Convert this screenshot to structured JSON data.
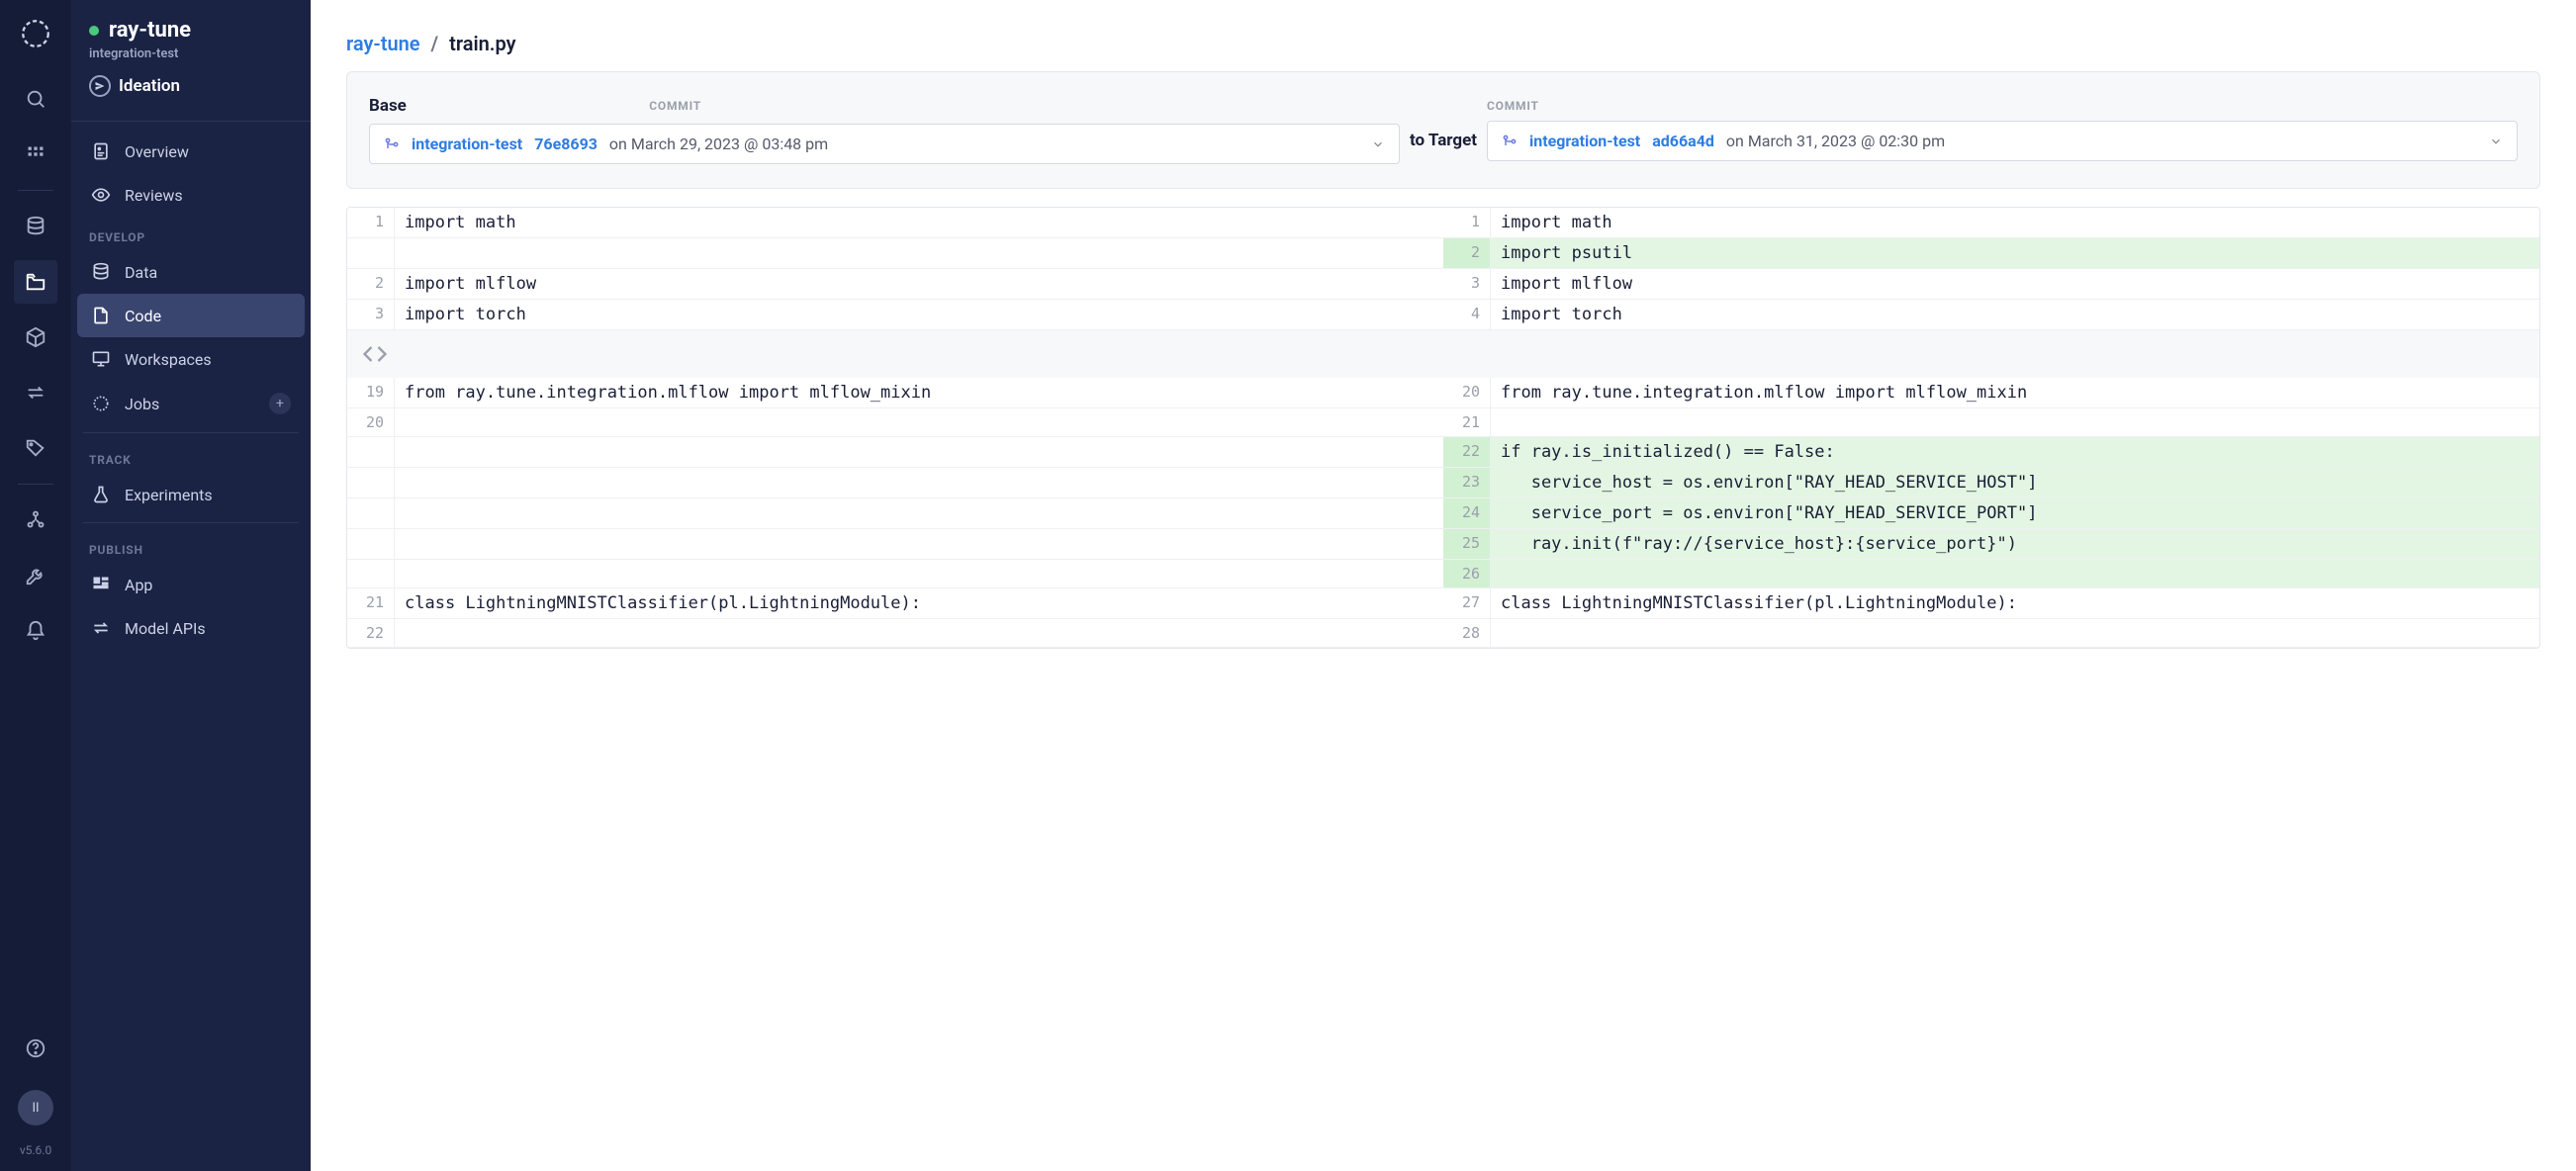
{
  "rail": {
    "version": "v5.6.0",
    "avatar_initials": "II"
  },
  "sidebar": {
    "project_title": "ray-tune",
    "project_subtitle": "integration-test",
    "stage_label": "Ideation",
    "sections": {
      "top": [
        {
          "label": "Overview"
        },
        {
          "label": "Reviews"
        }
      ],
      "develop_label": "DEVELOP",
      "develop": [
        {
          "label": "Data"
        },
        {
          "label": "Code"
        },
        {
          "label": "Workspaces"
        },
        {
          "label": "Jobs",
          "has_plus": true
        }
      ],
      "track_label": "TRACK",
      "track": [
        {
          "label": "Experiments"
        }
      ],
      "publish_label": "PUBLISH",
      "publish": [
        {
          "label": "App"
        },
        {
          "label": "Model APIs"
        }
      ]
    }
  },
  "breadcrumb": {
    "project": "ray-tune",
    "sep": "/",
    "file": "train.py"
  },
  "compare": {
    "base_label": "Base",
    "commit_label": "COMMIT",
    "to_target_label": "to Target",
    "base": {
      "branch": "integration-test",
      "hash": "76e8693",
      "date": "on March 29, 2023 @ 03:48 pm"
    },
    "target": {
      "branch": "integration-test",
      "hash": "ad66a4d",
      "date": "on March 31, 2023 @ 02:30 pm"
    }
  },
  "diff": {
    "rows": [
      {
        "l_no": "1",
        "l_code": "import math",
        "r_no": "1",
        "r_code": "import math",
        "r_added": false
      },
      {
        "l_no": "",
        "l_code": "",
        "r_no": "2",
        "r_code": "import psutil",
        "r_added": true
      },
      {
        "l_no": "2",
        "l_code": "import mlflow",
        "r_no": "3",
        "r_code": "import mlflow",
        "r_added": false
      },
      {
        "l_no": "3",
        "l_code": "import torch",
        "r_no": "4",
        "r_code": "import torch",
        "r_added": false
      },
      {
        "collapsed": true
      },
      {
        "l_no": "19",
        "l_code": "from ray.tune.integration.mlflow import mlflow_mixin",
        "r_no": "20",
        "r_code": "from ray.tune.integration.mlflow import mlflow_mixin",
        "r_added": false
      },
      {
        "l_no": "20",
        "l_code": "",
        "r_no": "21",
        "r_code": "",
        "r_added": false
      },
      {
        "l_no": "",
        "l_code": "",
        "r_no": "22",
        "r_code": "if ray.is_initialized() == False:",
        "r_added": true
      },
      {
        "l_no": "",
        "l_code": "",
        "r_no": "23",
        "r_code": "   service_host = os.environ[\"RAY_HEAD_SERVICE_HOST\"]",
        "r_added": true
      },
      {
        "l_no": "",
        "l_code": "",
        "r_no": "24",
        "r_code": "   service_port = os.environ[\"RAY_HEAD_SERVICE_PORT\"]",
        "r_added": true
      },
      {
        "l_no": "",
        "l_code": "",
        "r_no": "25",
        "r_code": "   ray.init(f\"ray://{service_host}:{service_port}\")",
        "r_added": true
      },
      {
        "l_no": "",
        "l_code": "",
        "r_no": "26",
        "r_code": "",
        "r_added": true
      },
      {
        "l_no": "21",
        "l_code": "class LightningMNISTClassifier(pl.LightningModule):",
        "r_no": "27",
        "r_code": "class LightningMNISTClassifier(pl.LightningModule):",
        "r_added": false
      },
      {
        "l_no": "22",
        "l_code": "",
        "r_no": "28",
        "r_code": "",
        "r_added": false
      }
    ]
  }
}
